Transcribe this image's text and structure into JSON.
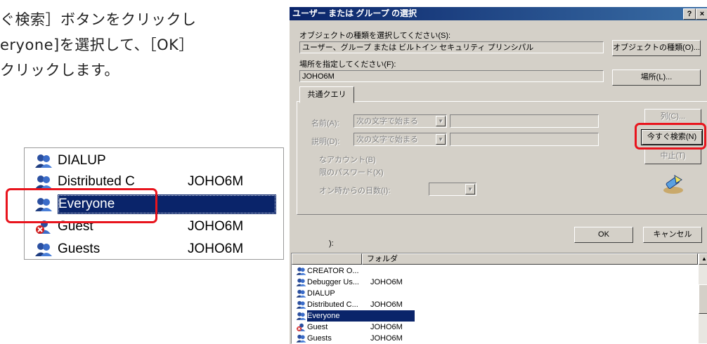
{
  "instructions": {
    "lines": [
      "ぐ検索］ボタンをクリックし",
      "eryone]を選択して、［OK］",
      "クリックします。"
    ]
  },
  "zoom_list": {
    "rows": [
      {
        "name": "DIALUP",
        "domain": "",
        "icon": "group-icon"
      },
      {
        "name": "Distributed C",
        "domain": "JOHO6M",
        "icon": "group-icon"
      },
      {
        "name": "Everyone",
        "domain": "",
        "icon": "group-icon"
      },
      {
        "name": "Guest",
        "domain": "JOHO6M",
        "icon": "user-disabled-icon"
      },
      {
        "name": "Guests",
        "domain": "JOHO6M",
        "icon": "group-icon"
      }
    ]
  },
  "dialog": {
    "title": "ユーザー または グループ の選択",
    "title_buttons": {
      "help": "?",
      "close": "×"
    },
    "object_type_label": "オブジェクトの種類を選択してください(S):",
    "object_type_value": "ユーザー、グループ または ビルトイン セキュリティ プリンシパル",
    "object_type_button": "オブジェクトの種類(O)...",
    "location_label": "場所を指定してください(F):",
    "location_value": "JOHO6M",
    "location_button": "場所(L)...",
    "tab_label": "共通クエリ",
    "name_label": "名前(A):",
    "desc_label": "説明(D):",
    "starts_with": "次の文字で始まる",
    "disabled_accounts": "なアカウント(B)",
    "no_expire_pw": "限のパスワード(X)",
    "days_since_logon": "オン時からの日数(I):",
    "columns_button": "列(C)...",
    "search_button": "今すぐ検索(N)",
    "stop_button": "中止(T)",
    "ok_button": "OK",
    "cancel_button": "キャンセル",
    "results_label": "):",
    "column_folder": "フォルダ",
    "accent_color": "#0a246a",
    "highlight_color": "#e8141d",
    "results": [
      {
        "name": "CREATOR O...",
        "domain": "",
        "icon": "group-icon"
      },
      {
        "name": "Debugger Us...",
        "domain": "JOHO6M",
        "icon": "group-icon"
      },
      {
        "name": "DIALUP",
        "domain": "",
        "icon": "group-icon"
      },
      {
        "name": "Distributed C...",
        "domain": "JOHO6M",
        "icon": "group-icon"
      },
      {
        "name": "Everyone",
        "domain": "",
        "icon": "group-icon"
      },
      {
        "name": "Guest",
        "domain": "JOHO6M",
        "icon": "user-disabled-icon"
      },
      {
        "name": "Guests",
        "domain": "JOHO6M",
        "icon": "group-icon"
      }
    ]
  }
}
